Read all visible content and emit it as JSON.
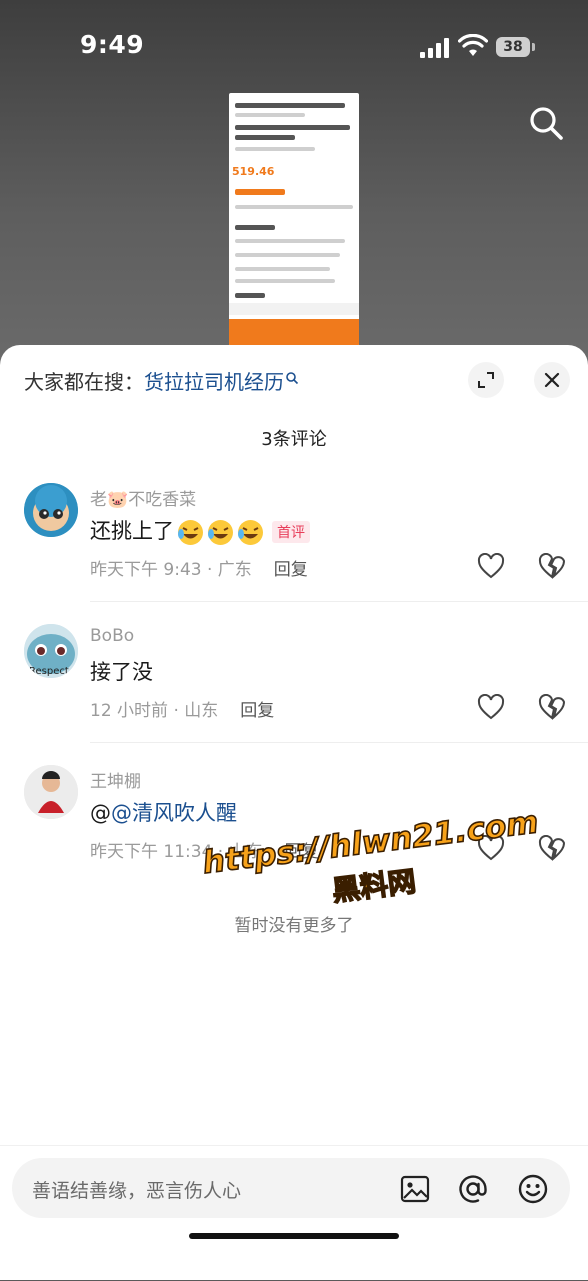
{
  "status_bar": {
    "time": "9:49",
    "battery": "38"
  },
  "thumbnail": {
    "price": "519.46"
  },
  "header": {
    "hot_prefix": "大家都在搜：",
    "hot_keyword": "货拉拉司机经历",
    "comment_count_title": "3条评论"
  },
  "comments": [
    {
      "username": "老🐷不吃香菜",
      "text": "还挑上了",
      "badge": "首评",
      "time_location": "昨天下午 9:43 · 广东",
      "reply_label": "回复"
    },
    {
      "username": "BoBo",
      "text": "接了没",
      "time_location": "12 小时前 · 山东",
      "reply_label": "回复"
    },
    {
      "username": "王坤棚",
      "text_prefix": "@",
      "mention": "@清风吹人醒",
      "time_location": "昨天下午 11:34 · 山东",
      "reply_label": "回复"
    }
  ],
  "footer_note": "暂时没有更多了",
  "input": {
    "placeholder": "善语结善缘，恶言伤人心"
  },
  "watermark": {
    "line1": "https://hlwn21.com",
    "line2": "黑料网"
  },
  "colors": {
    "link": "#1b4f8f",
    "badge": "#e83d5a",
    "watermark": "#f7a21a"
  }
}
